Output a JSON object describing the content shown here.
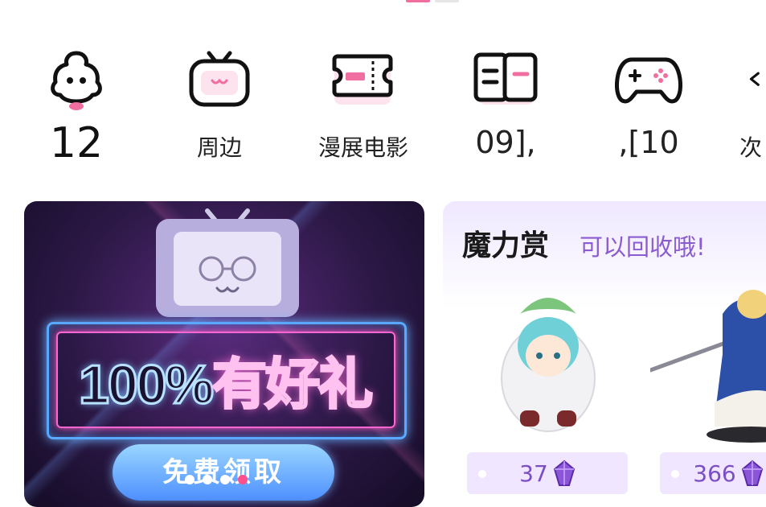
{
  "colors": {
    "accent_pink": "#f06fa0",
    "reward_purple": "#7a4fc4",
    "banner_blue": "#4d8fff"
  },
  "categories": [
    {
      "label": "12",
      "icon": "mascot-icon"
    },
    {
      "label": "周边",
      "icon": "tv-icon"
    },
    {
      "label": "漫展电影",
      "icon": "ticket-icon"
    },
    {
      "label": "09],",
      "icon": "book-icon"
    },
    {
      "label": ",[10",
      "icon": "gamepad-icon"
    },
    {
      "label": "次",
      "icon": "partial-icon"
    }
  ],
  "banner": {
    "headline_a": "100%",
    "headline_b": "有好礼",
    "cta": "免费领取",
    "active_slide": 4,
    "slide_count": 4
  },
  "reward": {
    "title": "魔力赏",
    "subtitle": "可以回收哦!",
    "items": [
      {
        "price": "37",
        "icon": "crystal-icon"
      },
      {
        "price": "366",
        "icon": "crystal-icon"
      }
    ]
  }
}
